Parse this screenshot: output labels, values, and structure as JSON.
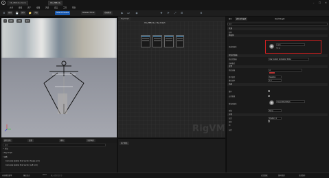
{
  "titlebar": {
    "logo": "U",
    "tabs": [
      "CR_VRBodie Demo",
      "CR_VRBody"
    ],
    "win_min": "–",
    "win_max": "□",
    "win_close": "✕"
  },
  "menubar": {
    "items": [
      "文件",
      "编辑",
      "资产",
      "视图",
      "调试",
      "窗口",
      "工具",
      "帮助"
    ]
  },
  "toolbar": {
    "compile": "编译",
    "save": "保存",
    "browse": "浏览",
    "mode": "Select Preview",
    "release": "Release Mode",
    "anim_mode": "动画模式"
  },
  "viewport": {
    "perspective": "透视",
    "lit": "光照",
    "show": "显示"
  },
  "rig_panel": {
    "tabs": [
      "绑定层级",
      "变量",
      "模块",
      "全部构建"
    ],
    "search_placeholder": "搜索",
    "rows": [
      "+ 添加",
      "▸ Rig Graph",
      "▾ 函数",
      "Calculate Spatial Pole Vector (Single Arm)",
      "Calculate Spatial Pole Vector (Left Arm)"
    ]
  },
  "graph": {
    "tab": "Rig Graph",
    "breadcrumb": "CR_VRBody  ›  Rig Graph",
    "watermark": "RigVM",
    "exec_tab": "执行堆栈"
  },
  "details": {
    "tabs": [
      "细节",
      "绑定层级设置",
      "预览场景设置"
    ],
    "search_placeholder": "搜索",
    "sections": {
      "general": "常规",
      "mesh": "网格体",
      "preview": "预览控制器",
      "settings": "设置",
      "anim": "动画",
      "misc": "杂项"
    },
    "props": {
      "name": "名称",
      "mesh_label": "预览网格体",
      "mesh_value": "Arm",
      "controller": "预览控制器",
      "controller_value": "Default",
      "anim_mode": "动画模式",
      "anim_value": "Use Custom Animation Mode",
      "custom_anim": "预览动画",
      "custom_anim_value": "无",
      "ref_pose": "参考姿势",
      "ref_value": "Skeleton",
      "play_rate": "播放速率",
      "play_value": "1.0",
      "looping": "循环",
      "enable_ik": "启用物理",
      "additional": "附加网格体",
      "additional_value": "BasicAttachMesh",
      "bone": "骨骼",
      "bone_value": "None",
      "position": "位置",
      "position_value": "Position_0",
      "scale": "缩放",
      "id": "ID",
      "tags": "标签"
    }
  },
  "statusbar": {
    "content": "内容侧滑菜单",
    "output": "输出日志",
    "cmd": "Cmd",
    "input": "输入控制台命令",
    "source": "源码管理",
    "derived": "派生数据",
    "right": "全部保存"
  }
}
